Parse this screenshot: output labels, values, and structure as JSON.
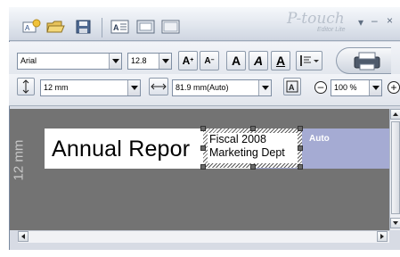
{
  "titlebar": {
    "brand_name": "P-touch",
    "brand_sub": "Editor Lite",
    "minimize": "–",
    "close": "×"
  },
  "font": {
    "family": "Arial",
    "size": "12.8"
  },
  "tape": {
    "width": "12 mm",
    "length": "81.9 mm(Auto)",
    "zoom": "100 %"
  },
  "format_buttons": {
    "grow": "A",
    "shrink": "A",
    "bold": "A",
    "italic": "A",
    "underline": "A"
  },
  "canvas": {
    "tape_size_label": "12 mm",
    "title_text": "Annual Repor",
    "selected_line1": "Fiscal 2008",
    "selected_line2": "Marketing Dept",
    "auto_label": "Auto"
  },
  "colors": {
    "canvas_bg": "#737373",
    "label_bg": "#ffffff",
    "auto_area": "#a5abd3"
  }
}
